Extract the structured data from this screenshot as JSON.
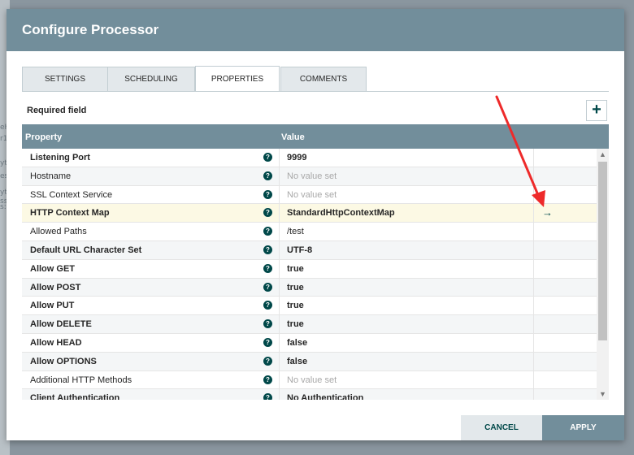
{
  "background": {
    "fragments": [
      "eH",
      "r1",
      "yt",
      "es",
      "yt",
      "ss",
      "s:0"
    ]
  },
  "dialog": {
    "title": "Configure Processor",
    "tabs": [
      {
        "label": "SETTINGS",
        "active": false
      },
      {
        "label": "SCHEDULING",
        "active": false
      },
      {
        "label": "PROPERTIES",
        "active": true
      },
      {
        "label": "COMMENTS",
        "active": false
      }
    ],
    "required_label": "Required field",
    "add_label": "+",
    "table": {
      "headers": {
        "property": "Property",
        "value": "Value"
      },
      "help_glyph": "?",
      "go_glyph": "→",
      "rows": [
        {
          "name": "Listening Port",
          "required": true,
          "value": "9999",
          "empty": false
        },
        {
          "name": "Hostname",
          "required": false,
          "value": "No value set",
          "empty": true
        },
        {
          "name": "SSL Context Service",
          "required": false,
          "value": "No value set",
          "empty": true
        },
        {
          "name": "HTTP Context Map",
          "required": true,
          "value": "StandardHttpContextMap",
          "empty": false,
          "highlight": true,
          "has_go": true
        },
        {
          "name": "Allowed Paths",
          "required": false,
          "value": "/test",
          "empty": false
        },
        {
          "name": "Default URL Character Set",
          "required": true,
          "value": "UTF-8",
          "empty": false
        },
        {
          "name": "Allow GET",
          "required": true,
          "value": "true",
          "empty": false
        },
        {
          "name": "Allow POST",
          "required": true,
          "value": "true",
          "empty": false
        },
        {
          "name": "Allow PUT",
          "required": true,
          "value": "true",
          "empty": false
        },
        {
          "name": "Allow DELETE",
          "required": true,
          "value": "true",
          "empty": false
        },
        {
          "name": "Allow HEAD",
          "required": true,
          "value": "false",
          "empty": false
        },
        {
          "name": "Allow OPTIONS",
          "required": true,
          "value": "false",
          "empty": false
        },
        {
          "name": "Additional HTTP Methods",
          "required": false,
          "value": "No value set",
          "empty": true
        },
        {
          "name": "Client Authentication",
          "required": true,
          "value": "No Authentication",
          "empty": false
        }
      ]
    },
    "buttons": {
      "cancel": "CANCEL",
      "apply": "APPLY"
    }
  },
  "colors": {
    "header": "#728e9b",
    "accent": "#004849",
    "annotation_arrow": "#ee2a2a",
    "highlight_row": "#fcf9e4"
  }
}
